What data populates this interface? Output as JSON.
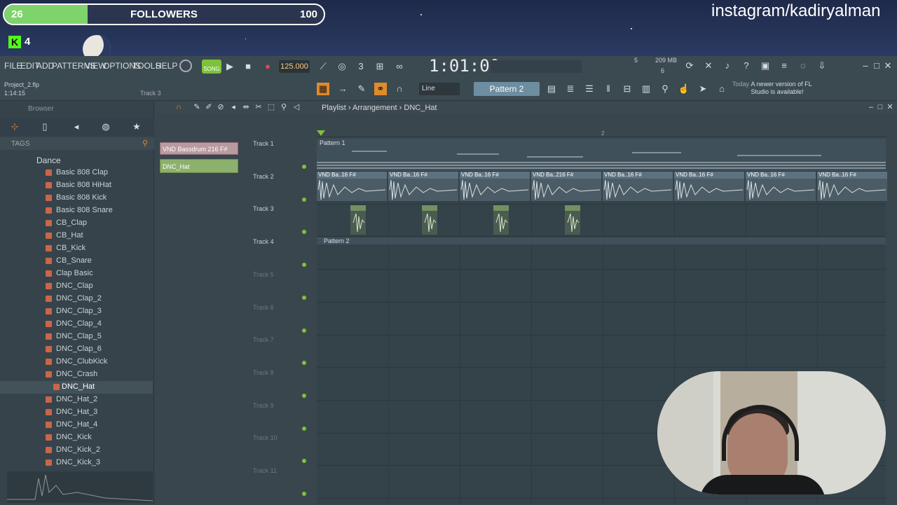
{
  "overlay": {
    "followers_count": "26",
    "followers_label": "FOLLOWERS",
    "followers_goal": "100",
    "followers_progress": 0.26,
    "kick_logo": "K",
    "kick_viewers": "4",
    "instagram": "instagram/kadiryalman"
  },
  "menu": {
    "file": "FILE",
    "edit": "EDIT",
    "add": "ADD",
    "patterns": "PATTERNS",
    "view": "VIEW",
    "options": "OPTIONS",
    "tools": "TOOLS",
    "help": "HELP"
  },
  "project": {
    "name": "Project_2.flp",
    "time": "1:14:15",
    "track": "Track 3"
  },
  "transport": {
    "song_mode": "SONG",
    "tempo": "125.000",
    "time": "1:01:00",
    "cpu": "5",
    "memory": "209 MB",
    "memory2": "6"
  },
  "toolbar2": {
    "snap": "Line",
    "pattern": "Pattern 2",
    "news_today": "Today",
    "news_text": "A newer version of FL Studio is available!"
  },
  "browser": {
    "title": "Browser",
    "tags": "TAGS",
    "folder": "Dance",
    "items": [
      "Basic 808 Clap",
      "Basic 808 HiHat",
      "Basic 808 Kick",
      "Basic 808 Snare",
      "CB_Clap",
      "CB_Hat",
      "CB_Kick",
      "CB_Snare",
      "Clap Basic",
      "DNC_Clap",
      "DNC_Clap_2",
      "DNC_Clap_3",
      "DNC_Clap_4",
      "DNC_Clap_5",
      "DNC_Clap_6",
      "DNC_ClubKick",
      "DNC_Crash",
      "DNC_Hat",
      "DNC_Hat_2",
      "DNC_Hat_3",
      "DNC_Hat_4",
      "DNC_Kick",
      "DNC_Kick_2",
      "DNC_Kick_3"
    ],
    "selected": "DNC_Hat"
  },
  "channels": [
    {
      "name": "VND Bassdrum 216 F#",
      "color": "#b99aa1"
    },
    {
      "name": "DNC_Hat",
      "color": "#8eb06d"
    }
  ],
  "playlist": {
    "breadcrumb": "Playlist › Arrangement › DNC_Hat",
    "ruler_mark": "2",
    "tracks": [
      "Track 1",
      "Track 2",
      "Track 3",
      "Track 4",
      "Track 5",
      "Track 6",
      "Track 7",
      "Track 8",
      "Track 9",
      "Track 10",
      "Track 11"
    ],
    "pattern1": "Pattern 1",
    "pattern2": "Pattern 2",
    "bass_clip_labels": [
      "VND Ba..16 F#",
      "VND Ba..16 F#",
      "VND Ba..16 F#",
      "VND Ba..216 F#",
      "VND Ba..16 F#",
      "VND Ba..16 F#",
      "VND Ba..16 F#",
      "VND Ba..16 F#"
    ]
  }
}
